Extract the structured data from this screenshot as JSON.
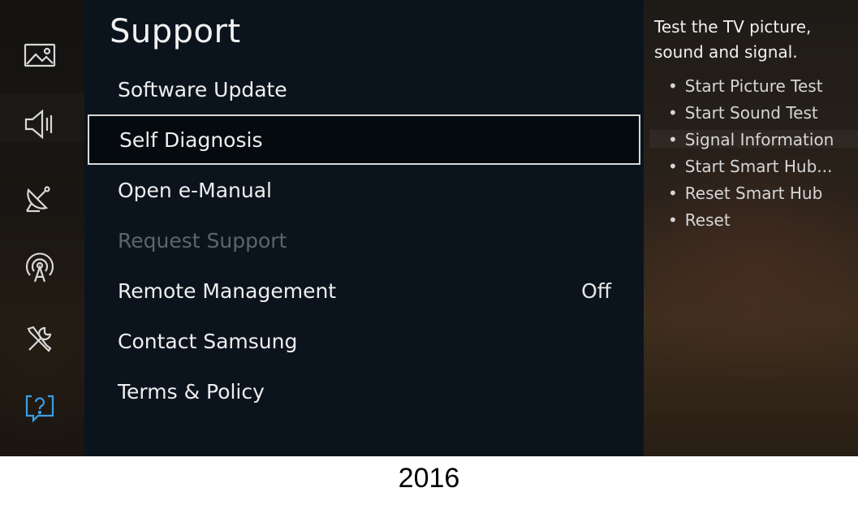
{
  "menu": {
    "title": "Support",
    "items": [
      {
        "label": "Software Update",
        "value": "",
        "state": "normal"
      },
      {
        "label": "Self Diagnosis",
        "value": "",
        "state": "focused"
      },
      {
        "label": "Open e-Manual",
        "value": "",
        "state": "normal"
      },
      {
        "label": "Request Support",
        "value": "",
        "state": "disabled"
      },
      {
        "label": "Remote Management",
        "value": "Off",
        "state": "normal"
      },
      {
        "label": "Contact Samsung",
        "value": "",
        "state": "normal"
      },
      {
        "label": "Terms & Policy",
        "value": "",
        "state": "normal"
      }
    ]
  },
  "sidebar": {
    "icons": [
      {
        "name": "picture-icon"
      },
      {
        "name": "sound-icon"
      },
      {
        "name": "broadcasting-icon"
      },
      {
        "name": "network-icon"
      },
      {
        "name": "system-icon"
      },
      {
        "name": "support-icon",
        "active": true
      }
    ],
    "active_color": "#3aa0e6",
    "icon_color": "#d8d8d8"
  },
  "info": {
    "description": "Test the TV picture, sound and signal.",
    "bullets": [
      "Start Picture Test",
      "Start Sound Test",
      "Signal Information",
      "Start Smart Hub...",
      "Reset Smart Hub",
      "Reset"
    ]
  },
  "caption": "2016"
}
